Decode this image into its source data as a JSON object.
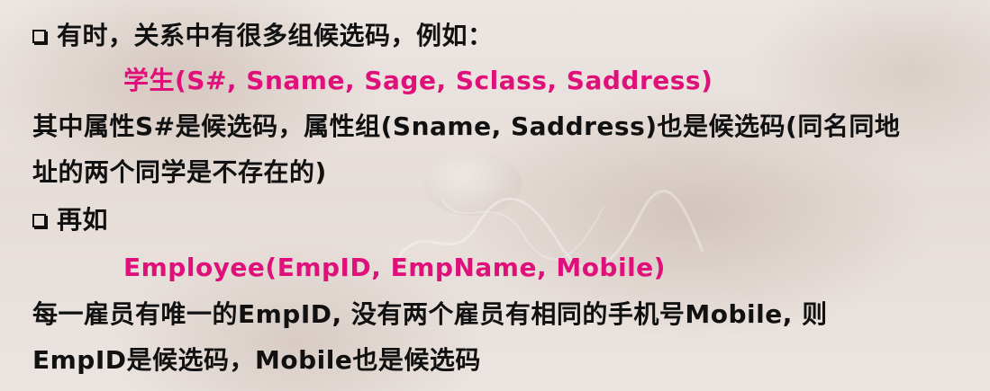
{
  "slide": {
    "bullet1": "有时，关系中有很多组候选码，例如：",
    "example1": "学生(S#, Sname, Sage, Sclass, Saddress)",
    "para1_line1": "其中属性S#是候选码，属性组(Sname, Saddress)也是候选码(同名同地",
    "para1_line2": "址的两个同学是不存在的)",
    "bullet2": "再如",
    "example2": "Employee(EmpID, EmpName, Mobile)",
    "para2_line1": "每一雇员有唯一的EmpID, 没有两个雇员有相同的手机号Mobile, 则",
    "para2_line2": "EmpID是候选码，Mobile也是候选码"
  },
  "colors": {
    "text": "#111111",
    "highlight": "#e0107a",
    "background": "#e9e1dd"
  },
  "icons": {
    "bullet": "hollow-square-bullet-icon"
  }
}
